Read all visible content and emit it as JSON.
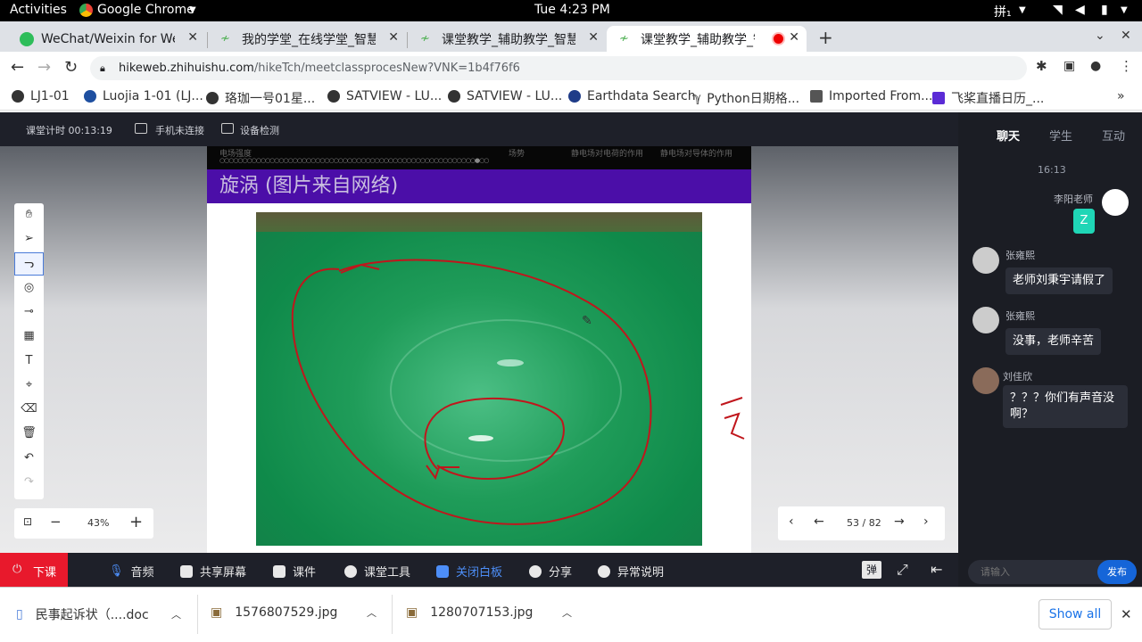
{
  "system": {
    "activities": "Activities",
    "app": "Google Chrome",
    "clock": "Tue  4:23 PM",
    "ime": "拼₁"
  },
  "tabs": [
    {
      "title": "WeChat/Weixin for Web"
    },
    {
      "title": "我的学堂_在线学堂_智慧树"
    },
    {
      "title": "课堂教学_辅助教学_智慧树"
    },
    {
      "title": "课堂教学_辅助教学_智慧树"
    }
  ],
  "address": {
    "host": "hikeweb.zhihuishu.com",
    "path": "/hikeTch/meetclassprocesNew?VNK=1b4f76f6"
  },
  "bookmarks": [
    "LJ1-01",
    "Luojia 1-01 (LJ...",
    "珞珈一号01星...",
    "SATVIEW - LU...",
    "SATVIEW - LU...",
    "Earthdata Search",
    "Python日期格...",
    "Imported From...",
    "飞桨直播日历_..."
  ],
  "appbar": {
    "timer": "课堂计时 00:13:19",
    "phone": "手机未连接",
    "device": "设备检测"
  },
  "slide": {
    "header_left": "电场强度",
    "header_mid": "场势",
    "header_right1": "静电场对电荷的作用",
    "header_right2": "静电场对导体的作用",
    "title": "旋涡 (图片来自网络)"
  },
  "zoom": {
    "value": "43%",
    "minus": "−",
    "plus": "+"
  },
  "pager": {
    "current": "53 / 82"
  },
  "chat": {
    "tabs": [
      "聊天",
      "学生",
      "互动"
    ],
    "time": "16:13",
    "messages": [
      {
        "sender": "李阳老师",
        "text": "Z"
      },
      {
        "sender": "张雍熙",
        "text": "老师刘秉宇请假了"
      },
      {
        "sender": "张雍熙",
        "text": "没事，老师辛苦"
      },
      {
        "sender": "刘佳欣",
        "text": "？？？你们有声音没啊？"
      }
    ],
    "input_placeholder": "请输入",
    "send": "发布",
    "danmu": "弹"
  },
  "bottom": {
    "end": "下课",
    "audio": "音频",
    "share": "共享屏幕",
    "courseware": "课件",
    "tools": "课堂工具",
    "whiteboard": "关闭白板",
    "sharelink": "分享",
    "issue": "异常说明"
  },
  "downloads": {
    "items": [
      "民事起诉状（....doc",
      "1576807529.jpg",
      "1280707153.jpg"
    ],
    "show_all": "Show all"
  },
  "colors": {
    "accent": "#1a73e8",
    "end_class": "#e8192c",
    "slide_title": "#4b0ea8",
    "ink": "#c0161c",
    "chat_accent": "#1565d8",
    "teacher_bubble": "#1fd6b6"
  }
}
